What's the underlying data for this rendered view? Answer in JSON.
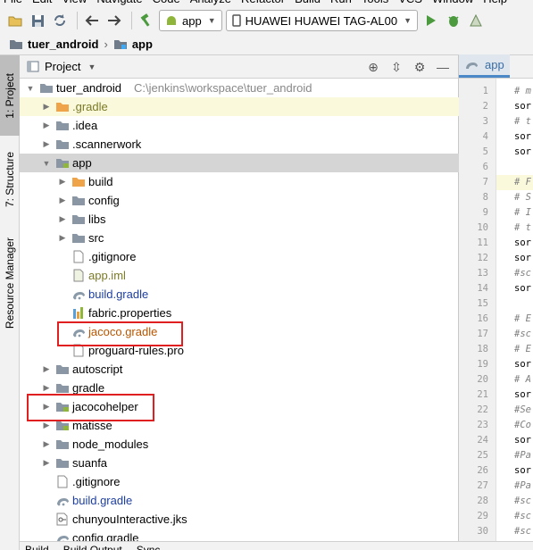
{
  "menubar": {
    "items": [
      "File",
      "Edit",
      "View",
      "Navigate",
      "Code",
      "Analyze",
      "Refactor",
      "Build",
      "Run",
      "Tools",
      "VCS",
      "Window",
      "Help"
    ]
  },
  "toolbar": {
    "run_config": "app",
    "device": "HUAWEI HUAWEI TAG-AL00"
  },
  "breadcrumb": {
    "project": "tuer_android",
    "module": "app"
  },
  "stripe": {
    "project_tab": "1: Project",
    "structure_tab": "7: Structure",
    "resource_tab": "Resource Manager"
  },
  "panel": {
    "title": "Project"
  },
  "tree": [
    {
      "label": "tuer_android",
      "path": "C:\\jenkins\\workspace\\tuer_android",
      "icon": "folder-icon",
      "depth": 0,
      "expanded": true
    },
    {
      "label": ".gradle",
      "icon": "orange-folder-icon",
      "depth": 1,
      "expanded": false,
      "color": "olive",
      "highlight": true
    },
    {
      "label": ".idea",
      "icon": "folder-icon",
      "depth": 1,
      "expanded": false
    },
    {
      "label": ".scannerwork",
      "icon": "folder-icon",
      "depth": 1,
      "expanded": false
    },
    {
      "label": "app",
      "icon": "module-folder-icon",
      "depth": 1,
      "expanded": true,
      "selected": true
    },
    {
      "label": "build",
      "icon": "orange-folder-icon",
      "depth": 2,
      "expanded": false
    },
    {
      "label": "config",
      "icon": "folder-icon",
      "depth": 2,
      "expanded": false
    },
    {
      "label": "libs",
      "icon": "folder-icon",
      "depth": 2,
      "expanded": false
    },
    {
      "label": "src",
      "icon": "folder-icon",
      "depth": 2,
      "expanded": false
    },
    {
      "label": ".gitignore",
      "icon": "file-icon",
      "depth": 2
    },
    {
      "label": "app.iml",
      "icon": "iml-file-icon",
      "depth": 2,
      "color": "olive"
    },
    {
      "label": "build.gradle",
      "icon": "gradle-icon",
      "depth": 2,
      "color": "blue"
    },
    {
      "label": "fabric.properties",
      "icon": "properties-file-icon",
      "depth": 2
    },
    {
      "label": "jacoco.gradle",
      "icon": "gradle-icon",
      "depth": 2,
      "color": "orange"
    },
    {
      "label": "proguard-rules.pro",
      "icon": "file-icon",
      "depth": 2
    },
    {
      "label": "autoscript",
      "icon": "folder-icon",
      "depth": 1,
      "expanded": false
    },
    {
      "label": "gradle",
      "icon": "folder-icon",
      "depth": 1,
      "expanded": false
    },
    {
      "label": "jacocohelper",
      "icon": "module-folder-icon",
      "depth": 1,
      "expanded": false
    },
    {
      "label": "matisse",
      "icon": "module-folder-icon",
      "depth": 1,
      "expanded": false
    },
    {
      "label": "node_modules",
      "icon": "folder-icon",
      "depth": 1,
      "expanded": false
    },
    {
      "label": "suanfa",
      "icon": "folder-icon",
      "depth": 1,
      "expanded": false
    },
    {
      "label": ".gitignore",
      "icon": "file-icon",
      "depth": 1
    },
    {
      "label": "build.gradle",
      "icon": "gradle-icon",
      "depth": 1,
      "color": "blue"
    },
    {
      "label": "chunyouInteractive.jks",
      "icon": "key-file-icon",
      "depth": 1
    },
    {
      "label": "config.gradle",
      "icon": "gradle-icon",
      "depth": 1
    }
  ],
  "editor": {
    "tab_label": "app",
    "lines": [
      {
        "n": "1",
        "text": "# m",
        "comment": true
      },
      {
        "n": "2",
        "text": "sor",
        "comment": false
      },
      {
        "n": "3",
        "text": "# t",
        "comment": true
      },
      {
        "n": "4",
        "text": "sor",
        "comment": false
      },
      {
        "n": "5",
        "text": "sor",
        "comment": false
      },
      {
        "n": "6",
        "text": "",
        "comment": false
      },
      {
        "n": "7",
        "text": "# F",
        "comment": true,
        "highlight": true
      },
      {
        "n": "8",
        "text": "# S",
        "comment": true
      },
      {
        "n": "9",
        "text": "# I",
        "comment": true
      },
      {
        "n": "10",
        "text": "# t",
        "comment": true
      },
      {
        "n": "11",
        "text": "sor",
        "comment": false
      },
      {
        "n": "12",
        "text": "sor",
        "comment": false
      },
      {
        "n": "13",
        "text": "#sc",
        "comment": true
      },
      {
        "n": "14",
        "text": "sor",
        "comment": false
      },
      {
        "n": "15",
        "text": "",
        "comment": false
      },
      {
        "n": "16",
        "text": "# E",
        "comment": true
      },
      {
        "n": "17",
        "text": "#sc",
        "comment": true
      },
      {
        "n": "18",
        "text": "# E",
        "comment": true
      },
      {
        "n": "19",
        "text": "sor",
        "comment": false
      },
      {
        "n": "20",
        "text": "# A",
        "comment": true
      },
      {
        "n": "21",
        "text": "sor",
        "comment": false
      },
      {
        "n": "22",
        "text": "#Se",
        "comment": true
      },
      {
        "n": "23",
        "text": "#Co",
        "comment": true
      },
      {
        "n": "24",
        "text": "sor",
        "comment": false
      },
      {
        "n": "25",
        "text": "#Pa",
        "comment": true
      },
      {
        "n": "26",
        "text": "sor",
        "comment": false
      },
      {
        "n": "27",
        "text": "#Pa",
        "comment": true
      },
      {
        "n": "28",
        "text": "#sc",
        "comment": true
      },
      {
        "n": "29",
        "text": "#sc",
        "comment": true
      },
      {
        "n": "30",
        "text": "#sc",
        "comment": true
      }
    ]
  },
  "bottom": {
    "tabs": [
      "Build",
      "Build Output",
      "Sync"
    ]
  },
  "colors": {
    "highlight_box": "#e02020",
    "selection": "#d5d5d5",
    "accent": "#4a88c7"
  }
}
